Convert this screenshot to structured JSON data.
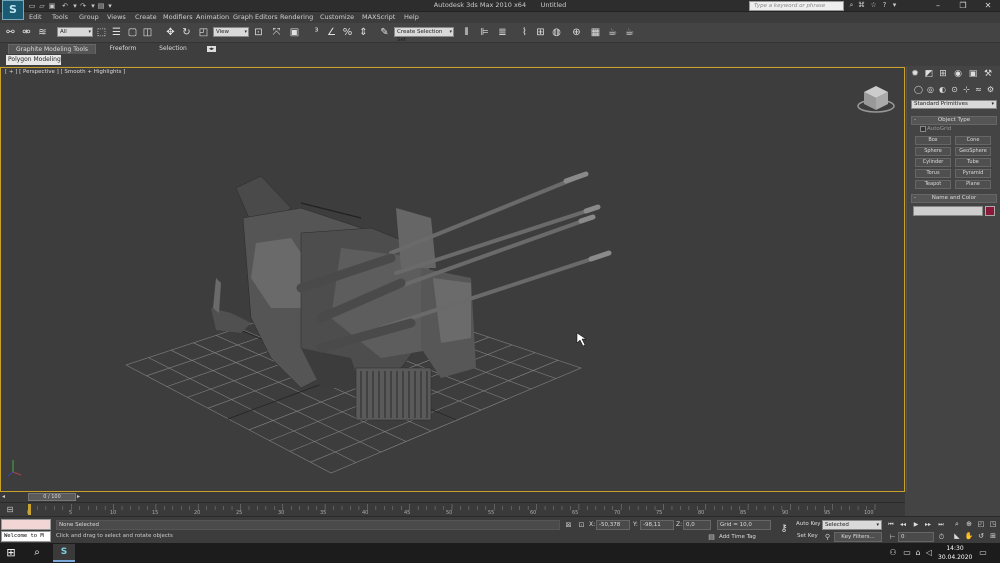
{
  "titlebar": {
    "app_title": "Autodesk 3ds Max 2010 x64",
    "doc_title": "Untitled",
    "search_placeholder": "Type a keyword or phrase",
    "logo_glyph": "S"
  },
  "menu": {
    "items": [
      "Edit",
      "Tools",
      "Group",
      "Views",
      "Create",
      "Modifiers",
      "Animation",
      "Graph Editors",
      "Rendering",
      "Customize",
      "MAXScript",
      "Help"
    ]
  },
  "toolbar": {
    "selection_filter": "All",
    "ref_coord": "View",
    "named_selection": "Create Selection Set"
  },
  "ribbon": {
    "tabs": [
      "Graphite Modeling Tools",
      "Freeform",
      "Selection"
    ],
    "active_panel": "Polygon Modeling"
  },
  "viewport": {
    "label": "[ + ] [ Perspective ] [ Smooth + Highlights ]"
  },
  "command_panel": {
    "category": "Standard Primitives",
    "object_type_title": "Object Type",
    "autogrid_label": "AutoGrid",
    "primitives": [
      "Box",
      "Cone",
      "Sphere",
      "GeoSphere",
      "Cylinder",
      "Tube",
      "Torus",
      "Pyramid",
      "Teapot",
      "Plane"
    ],
    "name_color_title": "Name and Color",
    "rollout_sign": "-",
    "object_color": "#8a1a3a"
  },
  "timeline": {
    "frame_counter": "0 / 100",
    "ticks": [
      "0",
      "5",
      "10",
      "15",
      "20",
      "25",
      "30",
      "35",
      "40",
      "45",
      "50",
      "55",
      "60",
      "65",
      "70",
      "75",
      "80",
      "85",
      "90",
      "95",
      "100"
    ]
  },
  "status": {
    "maxscript_text": "Welcome to M",
    "selection_status": "None Selected",
    "prompt": "Click and drag to select and rotate objects",
    "x_label": "X:",
    "x_value": "-50,378",
    "y_label": "Y:",
    "y_value": "-98,11",
    "z_label": "Z:",
    "z_value": "0,0",
    "grid": "Grid = 10,0",
    "add_time_tag": "Add Time Tag",
    "auto_key": "Auto Key",
    "set_key": "Set Key",
    "key_mode": "Selected",
    "key_filters": "Key Filters...",
    "current_frame": "0"
  },
  "taskbar": {
    "time": "14:30",
    "date": "30.04.2020",
    "app_glyph": "S"
  },
  "colors": {
    "viewport_border": "#c9a22a",
    "accent": "#7aa7d8"
  }
}
